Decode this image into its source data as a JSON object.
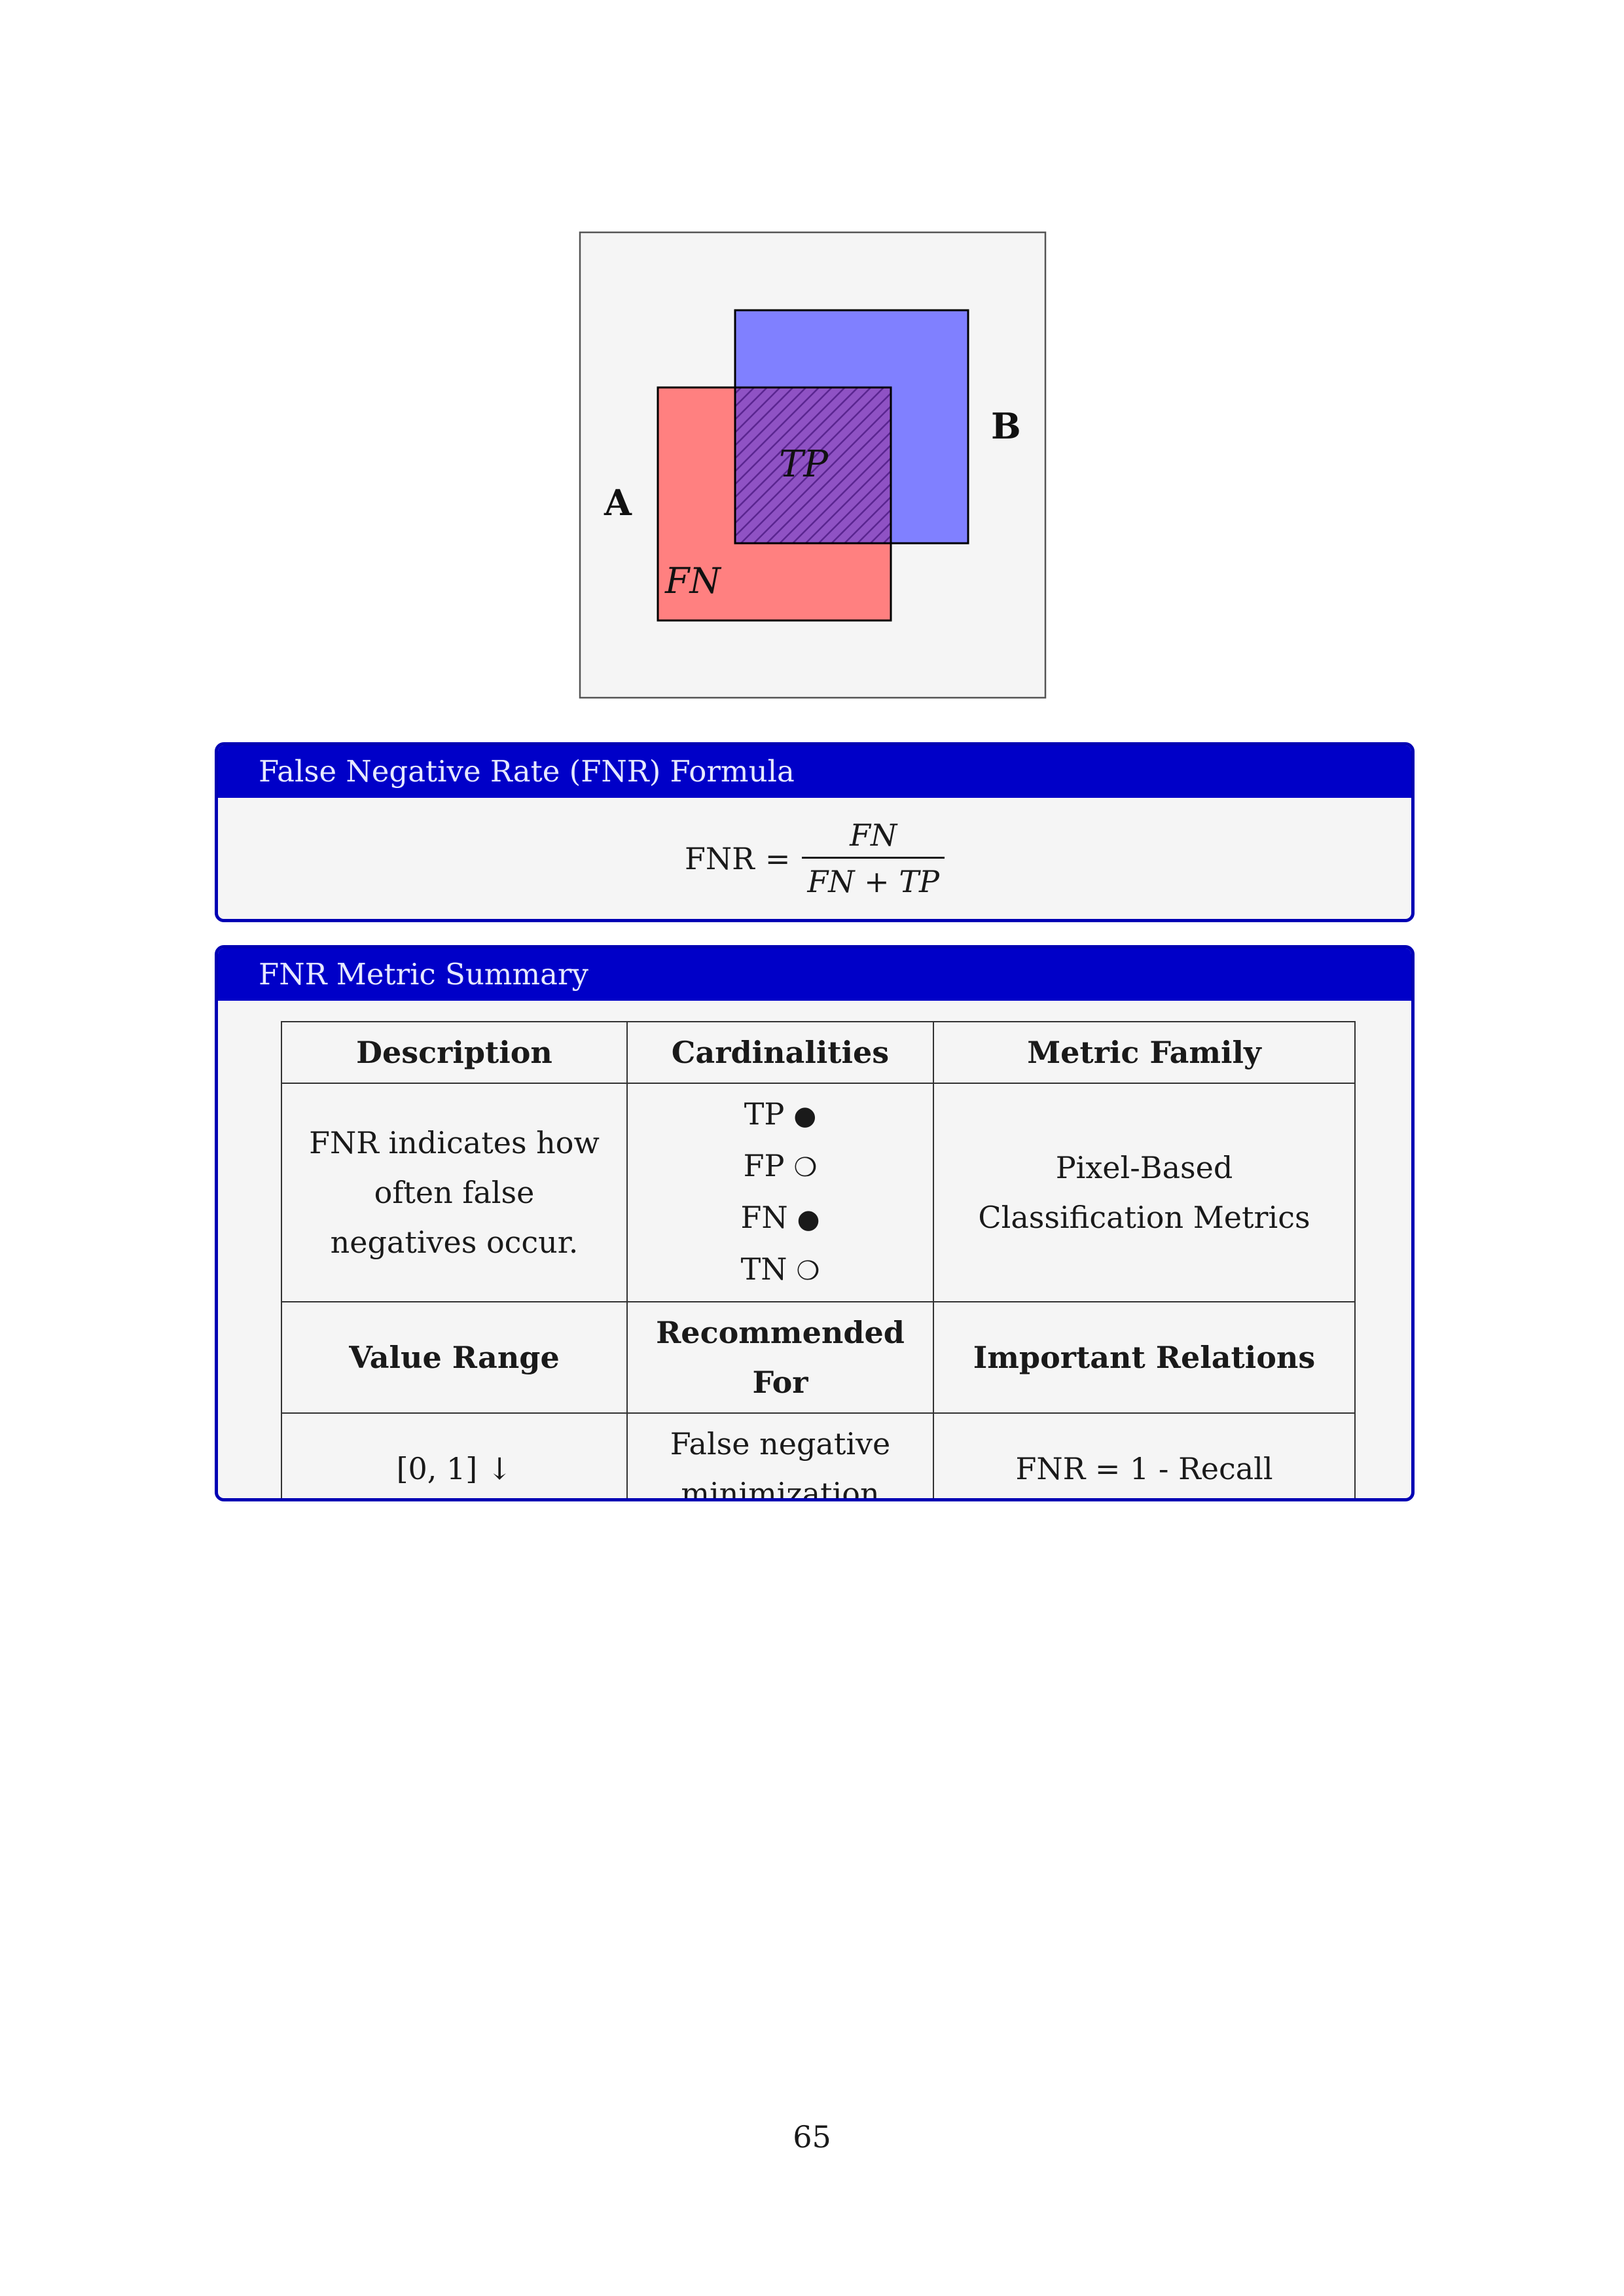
{
  "figure": {
    "label_a": "A",
    "label_b": "B",
    "label_tp": "TP",
    "label_fn": "FN",
    "colors": {
      "set_a": "#ff8080",
      "set_b": "#8080ff",
      "overlap_hatch": "#6b2fa0",
      "background": "#f5f5f5"
    }
  },
  "formula_box": {
    "title": "False Negative Rate (FNR) Formula",
    "lhs": "FNR",
    "equals": "=",
    "numerator": "FN",
    "denominator": "FN + TP"
  },
  "summary_box": {
    "title": "FNR Metric Summary",
    "headers": {
      "description": "Description",
      "cardinalities": "Cardinalities",
      "metric_family": "Metric Family"
    },
    "description": "FNR indicates how often false negatives occur.",
    "cardinalities": [
      {
        "label": "TP",
        "symbol": "●"
      },
      {
        "label": "FP",
        "symbol": "❍"
      },
      {
        "label": "FN",
        "symbol": "●"
      },
      {
        "label": "TN",
        "symbol": "❍"
      }
    ],
    "metric_family": "Pixel-Based Classification Metrics",
    "headers2": {
      "value_range": "Value Range",
      "recommended_for": "Recommended For",
      "important_relations": "Important Relations"
    },
    "value_range": "[0, 1] ↓",
    "recommended_for": "False negative minimization",
    "important_relations": "FNR = 1 - Recall"
  },
  "page_number": "65"
}
